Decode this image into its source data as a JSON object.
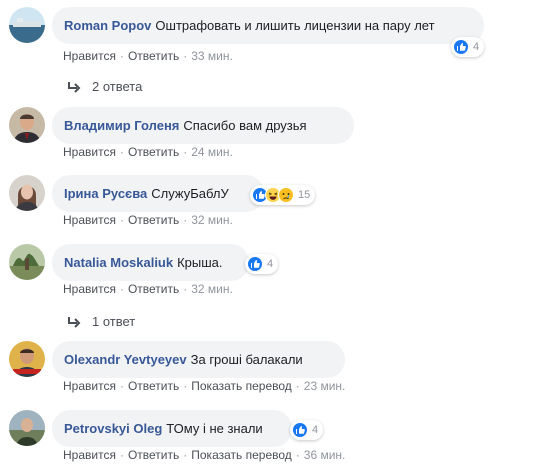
{
  "labels": {
    "like": "Нравится",
    "reply": "Ответить",
    "translate": "Показать перевод",
    "sep": "·"
  },
  "comments": [
    {
      "author": "Roman Popov",
      "text": "Оштрафовать и лишить лицензии на пару лет",
      "reactions_count": "4",
      "time": "33 мин.",
      "replies": "2 ответа"
    },
    {
      "author": "Владимир Голеня",
      "text": "Спасибо вам друзья",
      "time": "24 мин."
    },
    {
      "author": "Ірина Русєва",
      "text": "СлужуБаблУ",
      "reactions_count": "15",
      "time": "32 мин."
    },
    {
      "author": "Natalia Moskaliuk",
      "text": "Крыша.",
      "reactions_count": "4",
      "time": "32 мин.",
      "replies": "1 ответ"
    },
    {
      "author": "Olexandr Yevtyeyev",
      "text": "За гроші балакали",
      "time": "23 мин."
    },
    {
      "author": "Petrovskyi Oleg",
      "text": "ТОму і не знали",
      "reactions_count": "4",
      "time": "36 мин."
    }
  ],
  "colors": {
    "author": "#385898",
    "bubble": "#f2f3f5",
    "like": "#1877f2",
    "meta": "#90949c"
  }
}
